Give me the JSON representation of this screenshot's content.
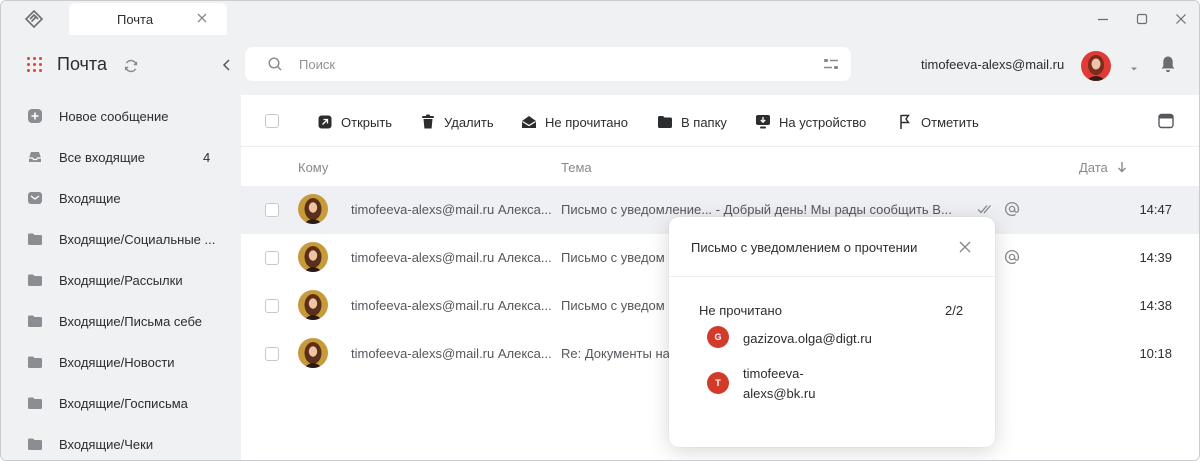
{
  "app": {
    "tab_title": "Почта"
  },
  "sidebar": {
    "title": "Почта",
    "items": [
      {
        "label": "Новое сообщение",
        "icon": "plus-circle-icon",
        "count": ""
      },
      {
        "label": "Все входящие",
        "icon": "inbox-tray-icon",
        "count": "4"
      },
      {
        "label": "Входящие",
        "icon": "envelope-icon",
        "count": ""
      },
      {
        "label": "Входящие/Социальные ...",
        "icon": "folder-icon",
        "count": ""
      },
      {
        "label": "Входящие/Рассылки",
        "icon": "folder-icon",
        "count": ""
      },
      {
        "label": "Входящие/Письма себе",
        "icon": "folder-icon",
        "count": ""
      },
      {
        "label": "Входящие/Новости",
        "icon": "folder-icon",
        "count": ""
      },
      {
        "label": "Входящие/Госписьма",
        "icon": "folder-icon",
        "count": ""
      },
      {
        "label": "Входящие/Чеки",
        "icon": "folder-icon",
        "count": ""
      }
    ]
  },
  "search": {
    "placeholder": "Поиск",
    "value": ""
  },
  "account": {
    "email": "timofeeva-alexs@mail.ru"
  },
  "toolbar": {
    "open": "Открыть",
    "delete": "Удалить",
    "unread": "Не прочитано",
    "to_folder": "В папку",
    "to_device": "На устройство",
    "flag": "Отметить"
  },
  "columns": {
    "to": "Кому",
    "subject": "Тема",
    "date": "Дата"
  },
  "messages": [
    {
      "to": "timofeeva-alexs@mail.ru Алекса...",
      "subject": "Письмо с уведомление...  - Добрый день! Мы рады сообщить В...",
      "time": "14:47",
      "selected": true,
      "read_mark": true,
      "at_mark": true
    },
    {
      "to": "timofeeva-alexs@mail.ru Алекса...",
      "subject": "Письмо с уведом",
      "time": "14:39",
      "selected": false,
      "read_mark": false,
      "at_mark": true
    },
    {
      "to": "timofeeva-alexs@mail.ru Алекса...",
      "subject": "Письмо с уведом",
      "time": "14:38",
      "selected": false,
      "read_mark": false,
      "at_mark": false
    },
    {
      "to": "timofeeva-alexs@mail.ru Алекса...",
      "subject": "Re: Документы на",
      "time": "10:18",
      "selected": false,
      "read_mark": false,
      "at_mark": false
    }
  ],
  "popup": {
    "title": "Письмо с уведомлением о прочтении",
    "status": "Не прочитано",
    "count": "2/2",
    "recipients": [
      {
        "initial": "G",
        "email": "gazizova.olga@digt.ru"
      },
      {
        "initial": "T",
        "email": "timofeeva-\nalexs@bk.ru"
      }
    ]
  },
  "colors": {
    "accent": "#e0452e",
    "badge": "#d23a2a",
    "window_bg": "#f0f1f3",
    "selected_row": "#eff0f3"
  }
}
